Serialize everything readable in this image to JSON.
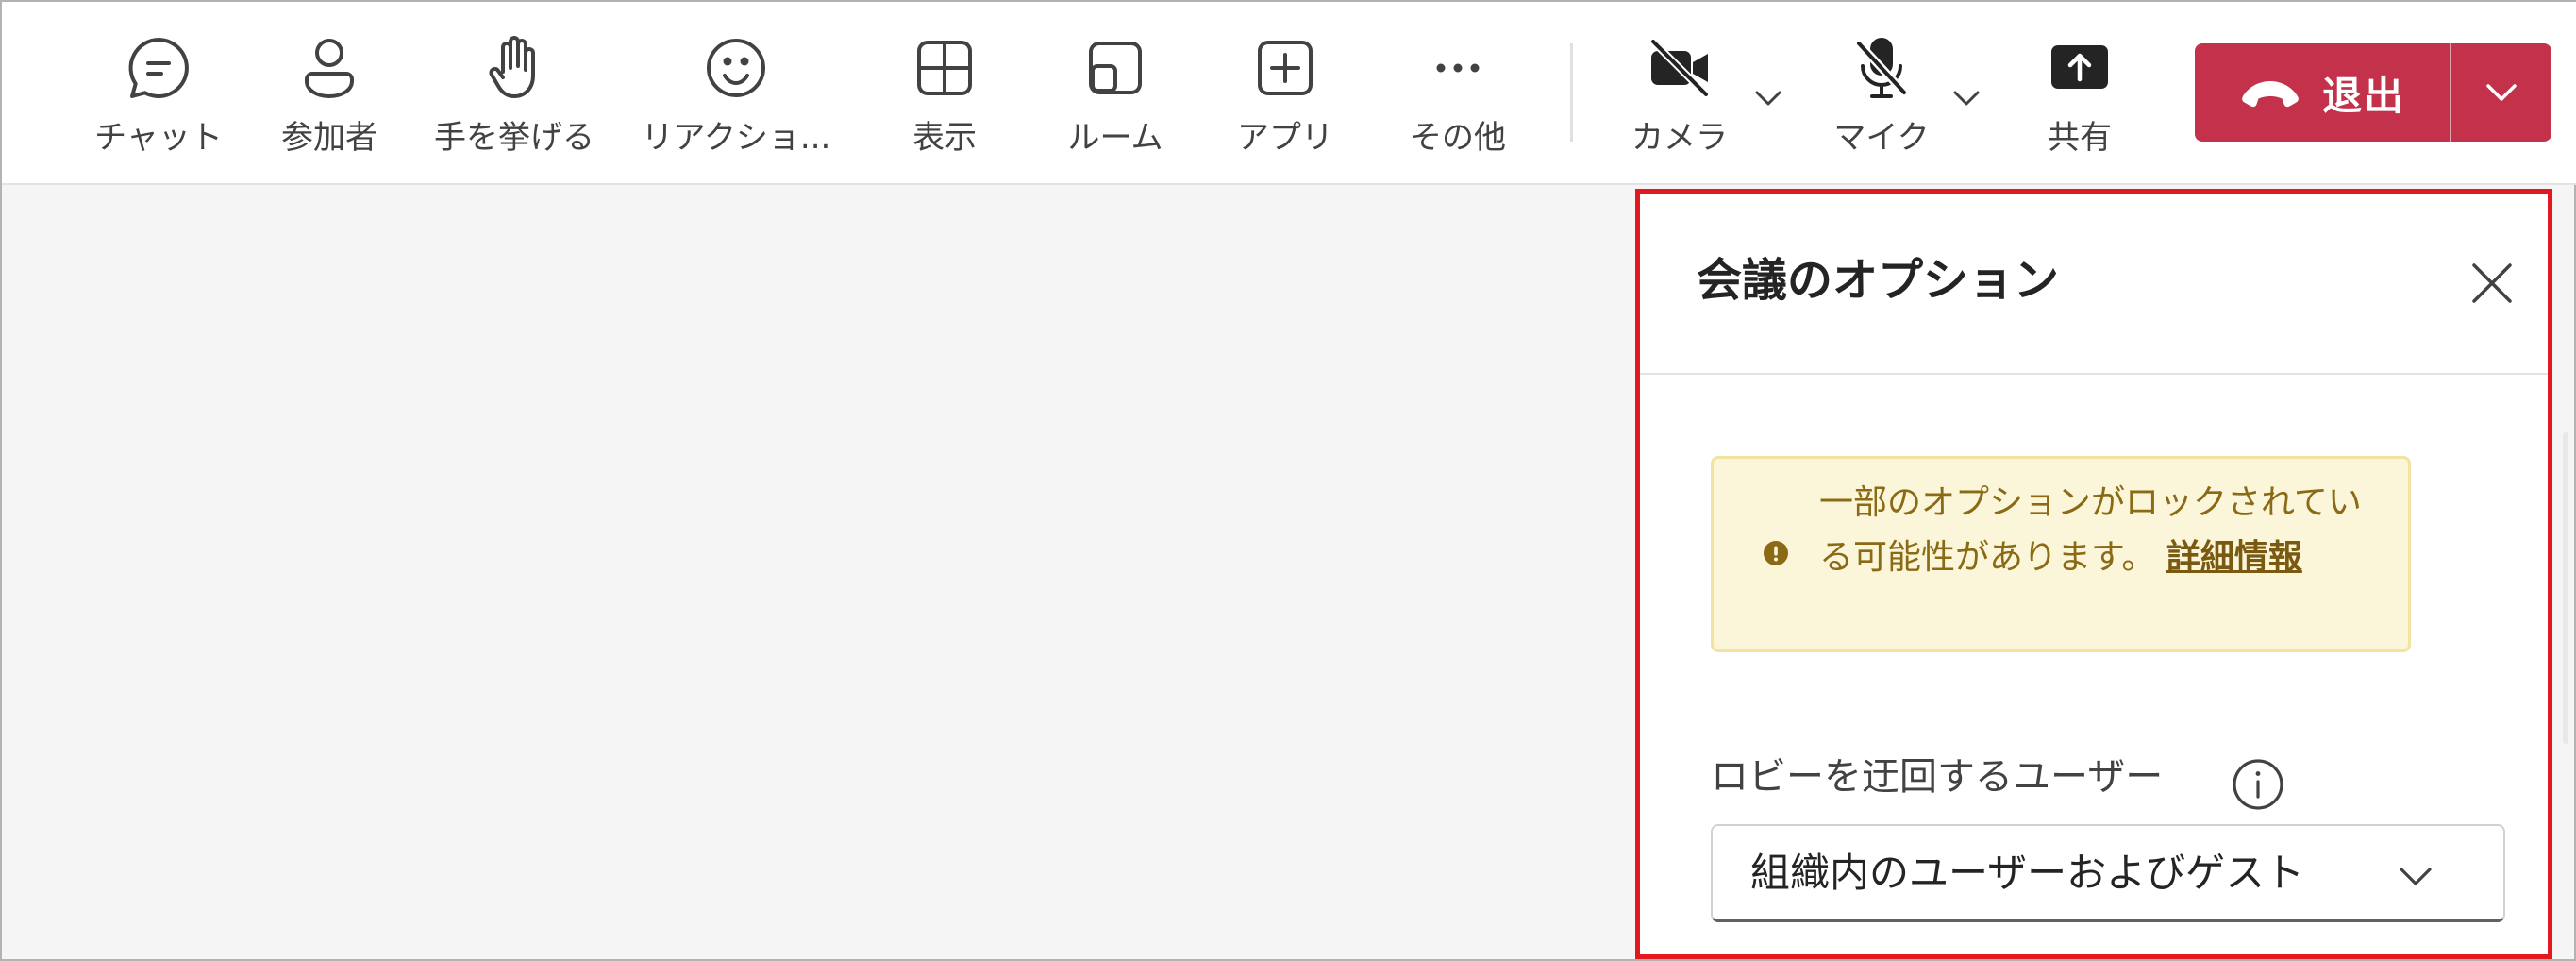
{
  "toolbar": {
    "items": [
      {
        "label": "チャット",
        "icon": "chat-icon"
      },
      {
        "label": "参加者",
        "icon": "people-icon"
      },
      {
        "label": "手を挙げる",
        "icon": "raise-hand-icon"
      },
      {
        "label": "リアクショ...",
        "icon": "emoji-icon"
      },
      {
        "label": "表示",
        "icon": "grid-view-icon"
      },
      {
        "label": "ルーム",
        "icon": "rooms-icon"
      },
      {
        "label": "アプリ",
        "icon": "add-app-icon"
      },
      {
        "label": "その他",
        "icon": "more-icon"
      }
    ],
    "camera_label": "カメラ",
    "mic_label": "マイク",
    "share_label": "共有",
    "leave_label": "退出"
  },
  "panel": {
    "title": "会議のオプション",
    "notice": {
      "text": "一部のオプションがロックされている可能性があります。 ",
      "link": "詳細情報"
    },
    "lobby_bypass": {
      "label": "ロビーを迂回するユーザー",
      "selected": "組織内のユーザーおよびゲスト"
    }
  },
  "colors": {
    "leave_button": "#c4314b",
    "highlight_border": "#e3191f",
    "notice_background": "#fbf6d9",
    "notice_text": "#8a6a15"
  }
}
